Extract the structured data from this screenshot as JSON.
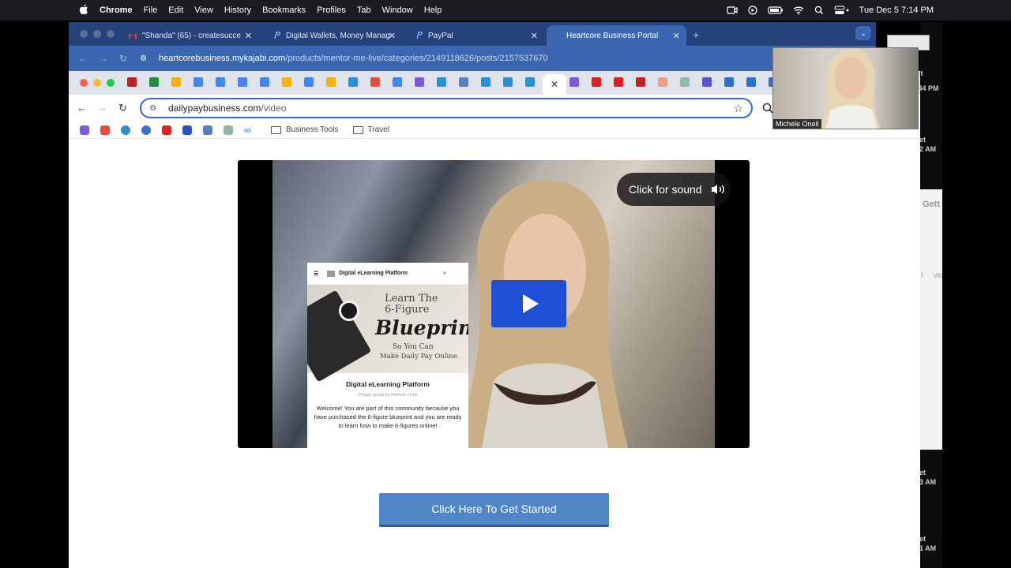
{
  "menubar": {
    "app_name": "Chrome",
    "items": [
      "File",
      "Edit",
      "View",
      "History",
      "Bookmarks",
      "Profiles",
      "Tab",
      "Window",
      "Help"
    ],
    "datetime": "Tue Dec 5  7:14 PM"
  },
  "back_window": {
    "tabs": [
      {
        "label": "\"Shanda\" (65) - createsucce",
        "icon": "gmail-icon"
      },
      {
        "label": "Digital Wallets, Money Manag",
        "icon": "paypal-icon"
      },
      {
        "label": "PayPal",
        "icon": "paypal-icon"
      },
      {
        "label": "Heartcore Business Portal",
        "icon": "",
        "active": true
      }
    ],
    "url_host": "heartcorebusiness.mykajabi.com",
    "url_path": "/products/mentor-me-live/categories/2149118626/posts/2157537670"
  },
  "front_window": {
    "url_host": "dailypaybusiness.com",
    "url_path": "/video",
    "bookmark_folders": [
      "Business Tools",
      "Travel"
    ]
  },
  "video": {
    "sound_label": "Click for sound",
    "mockup": {
      "header": "Digital eLearning Platform",
      "banner_line1": "Learn The",
      "banner_line2": "6-Figure",
      "banner_line3": "Blueprint",
      "banner_line4": "So You Can",
      "banner_line5": "Make Daily Pay Online",
      "title": "Digital eLearning Platform",
      "subtitle": "Private group by Michele Oneil",
      "description": "Welcome! You are part of this community because you have purchased the 6-figure blueprint and you are ready to learn how to make 6-figures online!"
    }
  },
  "cta_label": "Click Here To Get Started",
  "webcam": {
    "name": "Michele Oneil"
  },
  "side_fragments": [
    "ot",
    "3.44 PM",
    "et",
    "2 AM",
    "Gett",
    "f",
    "vic",
    "et",
    "3 AM",
    "et",
    "1 AM"
  ],
  "colors": {
    "accent_blue": "#2f6bd2",
    "play_blue": "#1f4fd6",
    "cta_blue": "#4f86c6"
  }
}
